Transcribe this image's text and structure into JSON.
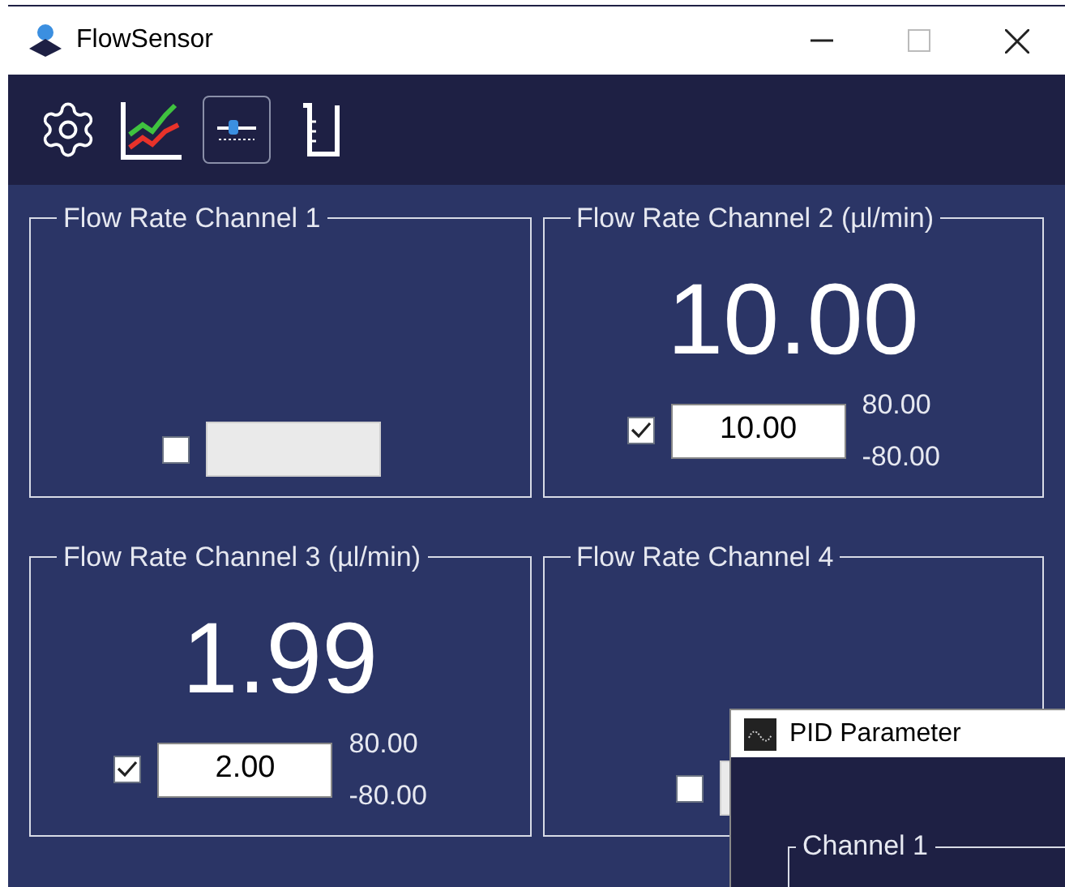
{
  "window": {
    "title": "FlowSensor"
  },
  "toolbar": [
    {
      "kind": "settings",
      "selected": false
    },
    {
      "kind": "chart",
      "selected": false
    },
    {
      "kind": "slider",
      "selected": true
    },
    {
      "kind": "beaker",
      "selected": false
    }
  ],
  "channels": [
    {
      "title": "Flow Rate Channel 1",
      "checked": false,
      "disabled": true
    },
    {
      "title": "Flow Rate Channel 2 (µl/min)",
      "reading": "10.00",
      "checked": true,
      "disabled": false,
      "value": "10.00",
      "max": "80.00",
      "min": "-80.00"
    },
    {
      "title": "Flow Rate Channel 3 (µl/min)",
      "reading": "1.99",
      "checked": true,
      "disabled": false,
      "value": "2.00",
      "max": "80.00",
      "min": "-80.00"
    },
    {
      "title": "Flow Rate Channel 4",
      "checked": false,
      "disabled": true
    }
  ],
  "pid_window": {
    "title": "PID Parameter",
    "group": "Channel 1"
  }
}
